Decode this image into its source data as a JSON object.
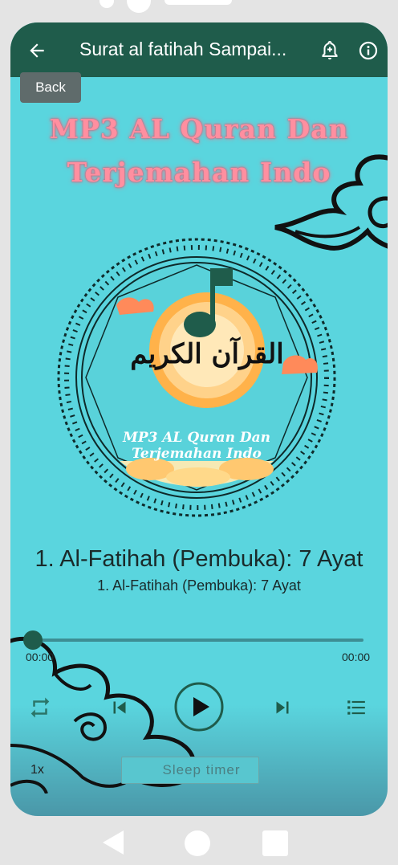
{
  "appbar": {
    "title": "Surat al fatihah Sampai...",
    "back_tooltip": "Back"
  },
  "promo": {
    "line1": "MP3 AL Quran Dan",
    "line2": "Terjemahan Indo"
  },
  "album_art": {
    "calligraphy": "القرآن الكريم",
    "line1": "MP3 AL Quran Dan",
    "line2": "Terjemahan Indo"
  },
  "track": {
    "title": "1. Al-Fatihah (Pembuka): 7 Ayat",
    "subtitle": "1. Al-Fatihah (Pembuka): 7 Ayat"
  },
  "seek": {
    "progress": 0,
    "current": "00:00",
    "duration": "00:00"
  },
  "controls": {
    "speed": "1x",
    "sleep_timer": "Sleep timer"
  },
  "colors": {
    "appbar": "#1f5c4b",
    "background": "#5ad5de",
    "accent": "#1f5c4b"
  }
}
